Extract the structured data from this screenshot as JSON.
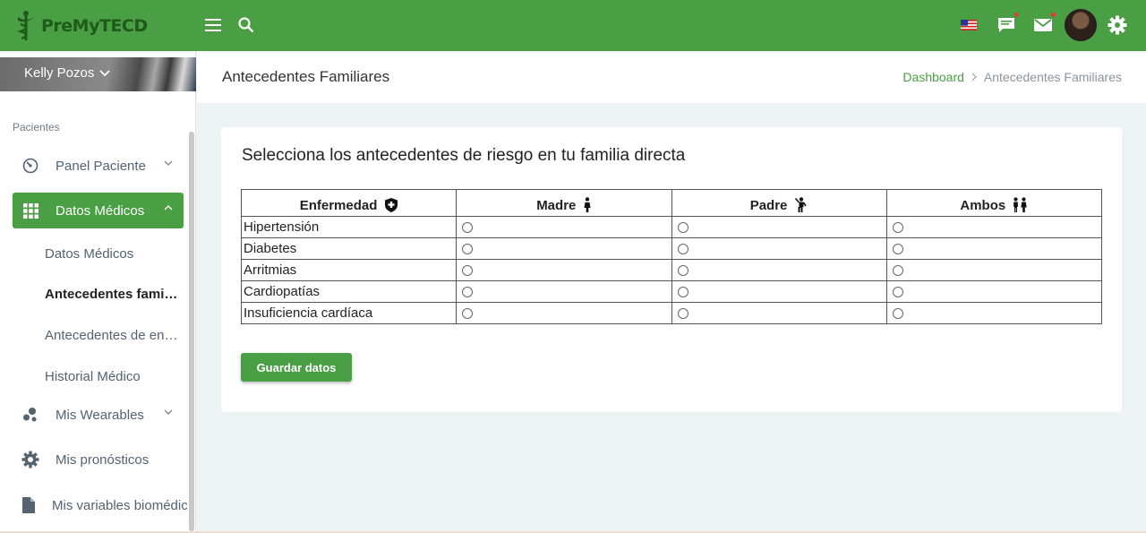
{
  "brand": {
    "name": "PreMyTECD"
  },
  "user": {
    "name": "Kelly Pozos"
  },
  "sidebar": {
    "section": "Pacientes",
    "items": [
      {
        "label": "Panel Paciente"
      },
      {
        "label": "Datos Médicos"
      },
      {
        "label": "Mis Wearables"
      },
      {
        "label": "Mis pronósticos"
      },
      {
        "label": "Mis variables biomédicas"
      }
    ],
    "sub_items": [
      {
        "label": "Datos Médicos"
      },
      {
        "label": "Antecedentes familiares"
      },
      {
        "label": "Antecedentes de enfermedad"
      },
      {
        "label": "Historial Médico"
      }
    ]
  },
  "header": {
    "title": "Antecedentes Familiares",
    "breadcrumb": [
      "Dashboard",
      "Antecedentes Familiares"
    ]
  },
  "card": {
    "title": "Selecciona los antecedentes de riesgo en tu familia directa",
    "columns": [
      "Enfermedad",
      "Madre",
      "Padre",
      "Ambos"
    ],
    "rows": [
      "Hipertensión",
      "Diabetes",
      "Arritmias",
      "Cardiopatías",
      "Insuficiencia cardíaca"
    ],
    "save_label": "Guardar datos"
  },
  "colors": {
    "primary": "#4a9e44",
    "background": "#edf2f5"
  }
}
